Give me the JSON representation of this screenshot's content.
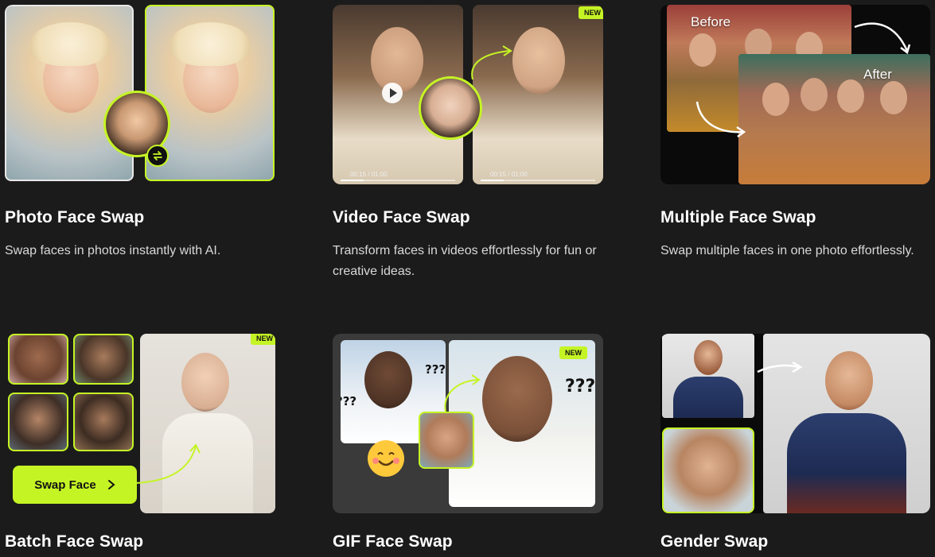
{
  "cards": [
    {
      "title": "Photo Face Swap",
      "description": "Swap faces in photos instantly with AI."
    },
    {
      "title": "Video Face Swap",
      "description": "Transform faces in videos effortlessly for fun or creative ideas.",
      "badge": "NEW",
      "video_time": "00:15 / 01:00"
    },
    {
      "title": "Multiple Face Swap",
      "description": "Swap multiple faces in one photo effortlessly.",
      "before_label": "Before",
      "after_label": "After"
    },
    {
      "title": "Batch Face Swap",
      "description": "",
      "badge": "NEW",
      "button_label": "Swap Face"
    },
    {
      "title": "GIF Face Swap",
      "description": "",
      "badge": "NEW",
      "question_marks": "???"
    },
    {
      "title": "Gender Swap",
      "description": ""
    }
  ],
  "colors": {
    "background": "#1b1b1b",
    "accent": "#c5f425",
    "text": "#ffffff",
    "muted_text": "#d9d9d9"
  }
}
